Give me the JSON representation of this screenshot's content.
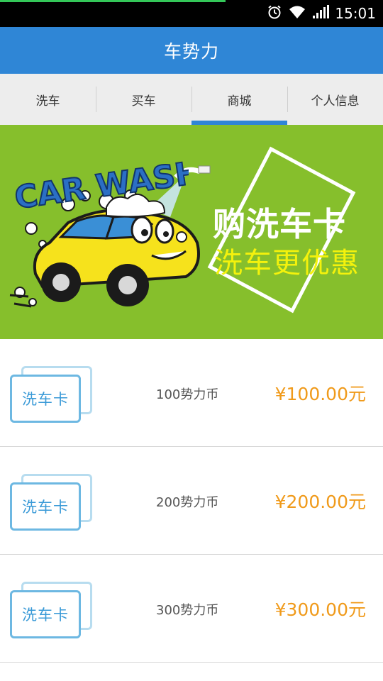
{
  "status_bar": {
    "time": "15:01",
    "icons": [
      "alarm-icon",
      "wifi-icon",
      "signal-icon"
    ]
  },
  "header": {
    "title": "车势力"
  },
  "tabs": [
    {
      "label": "洗车",
      "active": false
    },
    {
      "label": "买车",
      "active": false
    },
    {
      "label": "商城",
      "active": true
    },
    {
      "label": "个人信息",
      "active": false
    }
  ],
  "banner": {
    "logo_text": "CAR WASH",
    "headline": "购洗车卡",
    "subheadline": "洗车更优惠"
  },
  "products": [
    {
      "card_label": "洗车卡",
      "coins": "100势力币",
      "price": "¥100.00元"
    },
    {
      "card_label": "洗车卡",
      "coins": "200势力币",
      "price": "¥200.00元"
    },
    {
      "card_label": "洗车卡",
      "coins": "300势力币",
      "price": "¥300.00元"
    }
  ],
  "colors": {
    "primary": "#2f86d6",
    "banner_bg": "#86bf2c",
    "price": "#f09a1a",
    "card_border": "#6db8e2"
  }
}
